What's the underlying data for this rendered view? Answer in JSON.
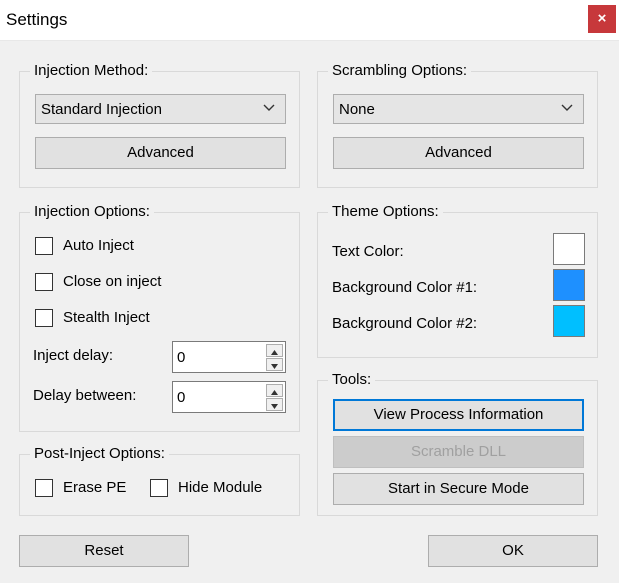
{
  "window": {
    "title": "Settings",
    "close_glyph": "×"
  },
  "injection_method": {
    "legend": "Injection Method:",
    "selected": "Standard Injection",
    "advanced_label": "Advanced"
  },
  "scrambling": {
    "legend": "Scrambling Options:",
    "selected": "None",
    "advanced_label": "Advanced"
  },
  "injection_options": {
    "legend": "Injection Options:",
    "auto_inject": {
      "label": "Auto Inject",
      "checked": false
    },
    "close_on_inject": {
      "label": "Close on inject",
      "checked": false
    },
    "stealth_inject": {
      "label": "Stealth Inject",
      "checked": false
    },
    "inject_delay": {
      "label": "Inject delay:",
      "value": "0"
    },
    "delay_between": {
      "label": "Delay between:",
      "value": "0"
    }
  },
  "post_inject": {
    "legend": "Post-Inject Options:",
    "erase_pe": {
      "label": "Erase PE",
      "checked": false
    },
    "hide_module": {
      "label": "Hide Module",
      "checked": false
    }
  },
  "theme": {
    "legend": "Theme Options:",
    "text_color": {
      "label": "Text Color:",
      "color": "#ffffff"
    },
    "bg1": {
      "label": "Background Color #1:",
      "color": "#1e90ff"
    },
    "bg2": {
      "label": "Background Color #2:",
      "color": "#00bfff"
    }
  },
  "tools": {
    "legend": "Tools:",
    "view_process": "View Process Information",
    "scramble_dll": "Scramble DLL",
    "secure_mode": "Start in Secure Mode"
  },
  "footer": {
    "reset_label": "Reset",
    "ok_label": "OK"
  },
  "icons": {
    "chevron": "chevron-down-icon",
    "close": "close-icon",
    "spin_up": "arrow-up-icon",
    "spin_down": "arrow-down-icon"
  }
}
